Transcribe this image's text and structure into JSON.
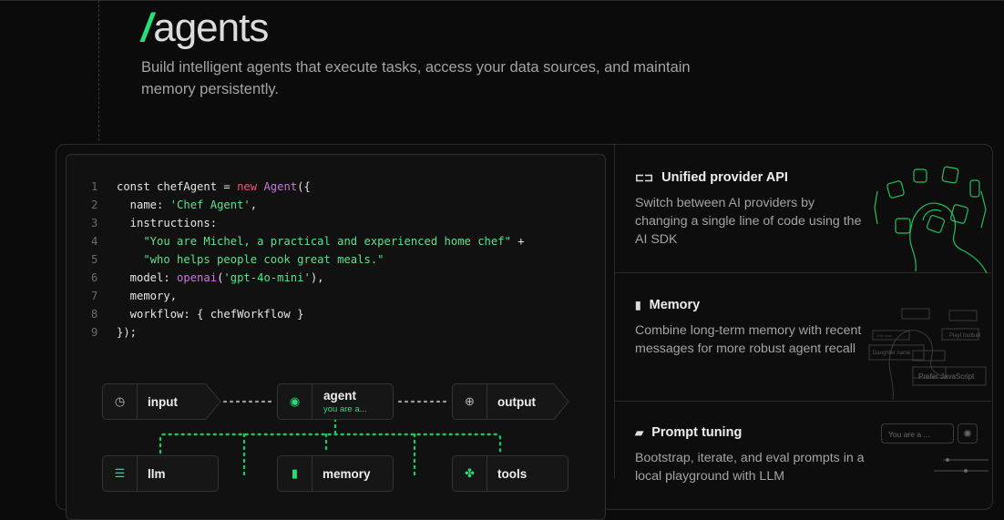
{
  "header": {
    "slash": "/",
    "title": "agents",
    "subtitle": "Build intelligent agents that execute tasks, access your data sources, and maintain memory persistently."
  },
  "code": {
    "lines": [
      {
        "n": "1"
      },
      {
        "n": "2"
      },
      {
        "n": "3"
      },
      {
        "n": "4"
      },
      {
        "n": "5"
      },
      {
        "n": "6"
      },
      {
        "n": "7"
      },
      {
        "n": "8"
      },
      {
        "n": "9"
      }
    ],
    "tokens": {
      "l1_a": "const chefAgent = ",
      "l1_kw": "new ",
      "l1_cls": "Agent",
      "l1_b": "({",
      "l2_a": "  name: ",
      "l2_str": "'Chef Agent'",
      "l2_b": ",",
      "l3_a": "  instructions:",
      "l4_str": "    \"You are Michel, a practical and experienced home chef\"",
      "l4_b": " +",
      "l5_str": "    \"who helps people cook great meals.\"",
      "l6_a": "  model: ",
      "l6_fn": "openai",
      "l6_b": "(",
      "l6_str": "'gpt-4o-mini'",
      "l6_c": "),",
      "l7_a": "  memory,",
      "l8_a": "  workflow: { chefWorkflow }",
      "l9_a": "});"
    }
  },
  "flow": {
    "input": "input",
    "agent": "agent",
    "agent_sub": "you are a...",
    "output": "output",
    "llm": "llm",
    "memory": "memory",
    "tools": "tools"
  },
  "features": [
    {
      "title": "Unified provider API",
      "desc": "Switch between AI providers by changing a single line of code using the AI SDK"
    },
    {
      "title": "Memory",
      "desc": "Combine long-term memory with recent messages for more robust agent recall"
    },
    {
      "title": "Prompt tuning",
      "desc": "Bootstrap, iterate, and eval prompts in a local playground with LLM"
    }
  ],
  "memory_illo": {
    "chip1": "Playt football",
    "chip2": "Daughter name",
    "chip3": "Prefer JavaScript",
    "chip4": "Vote data"
  },
  "prompt_illo": {
    "input": "You are a ..."
  },
  "colors": {
    "accent": "#22e07a",
    "keyword": "#f0547a",
    "class": "#c678dd",
    "string": "#5fe08b"
  }
}
